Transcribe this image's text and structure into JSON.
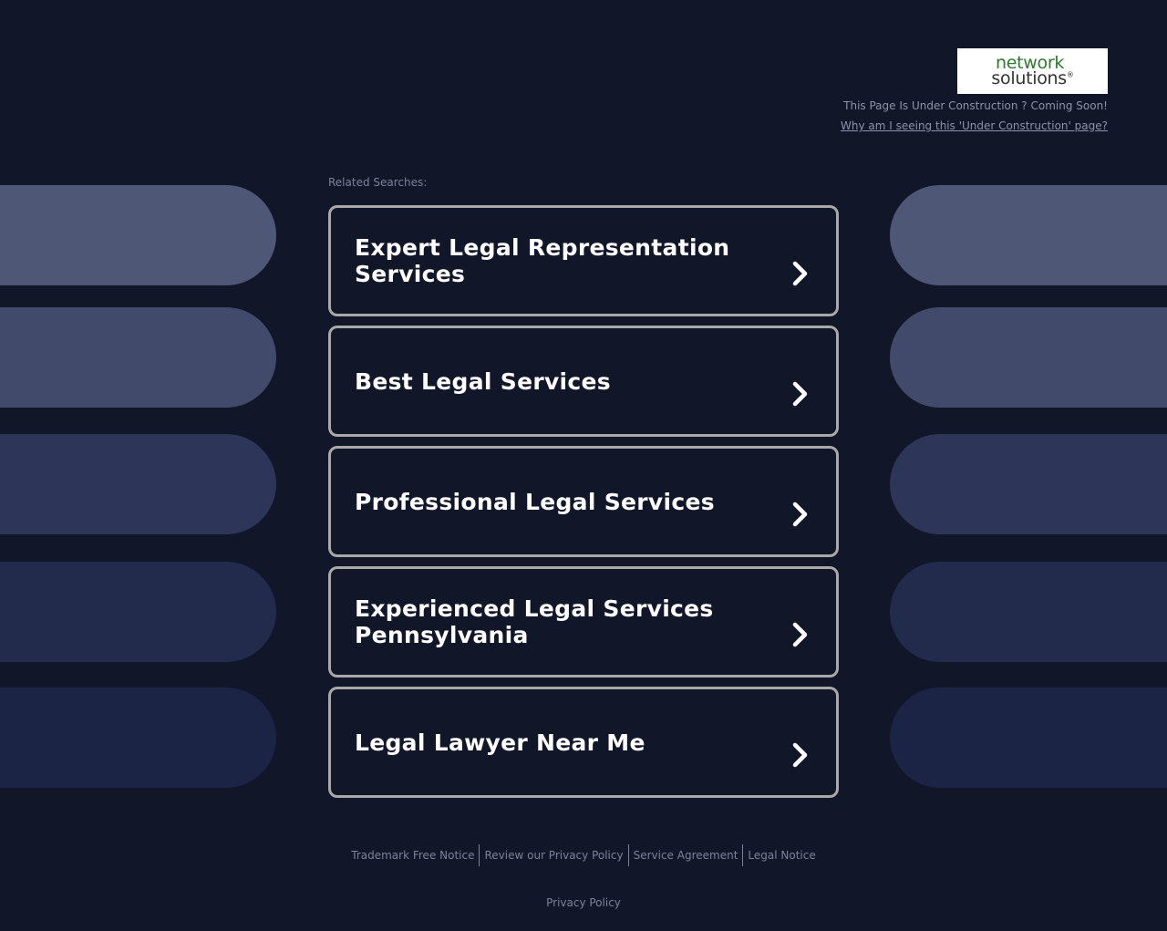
{
  "header": {
    "logo": {
      "top_text": "network",
      "bottom_text": "solutions",
      "registered_mark": "®",
      "green_color": "#2f7a2f"
    },
    "under_construction_text": "This Page Is Under Construction ? Coming Soon!",
    "why_link": "Why am I seeing this 'Under Construction' page?"
  },
  "main": {
    "related_label": "Related Searches:",
    "searches": [
      {
        "label": "Expert Legal Representation Services"
      },
      {
        "label": "Best Legal Services"
      },
      {
        "label": "Professional Legal Services"
      },
      {
        "label": "Experienced Legal Services Pennsylvania"
      },
      {
        "label": "Legal Lawyer Near Me"
      }
    ]
  },
  "footer": {
    "links": [
      {
        "label": "Trademark Free Notice"
      },
      {
        "label": "Review our Privacy Policy"
      },
      {
        "label": "Service Agreement"
      },
      {
        "label": "Legal Notice"
      }
    ],
    "privacy": "Privacy Policy"
  },
  "colors": {
    "background": "#111629",
    "card_border": "#a9a9a9",
    "muted_text": "#7c8399"
  }
}
